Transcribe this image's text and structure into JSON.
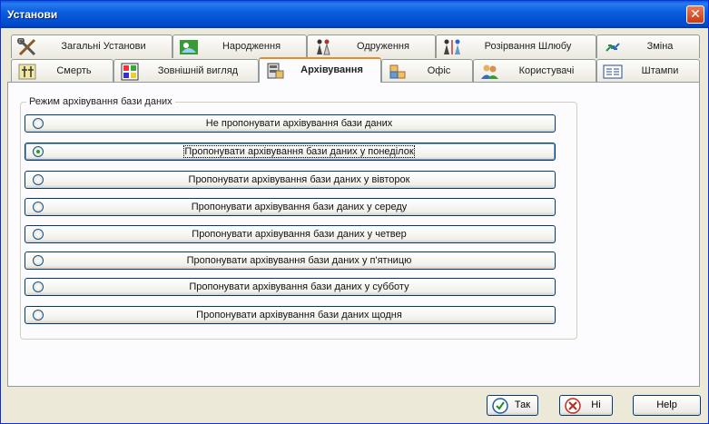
{
  "window": {
    "title": "Установи",
    "close_label": "✕"
  },
  "tabs_row1": [
    {
      "label": "Загальні Установи",
      "icon": "tools-icon"
    },
    {
      "label": "Народження",
      "icon": "birth-icon"
    },
    {
      "label": "Одруження",
      "icon": "wedding-icon"
    },
    {
      "label": "Розірвання Шлюбу",
      "icon": "divorce-icon"
    },
    {
      "label": "Зміна",
      "icon": "change-icon"
    }
  ],
  "tabs_row2": [
    {
      "label": "Смерть",
      "icon": "death-icon"
    },
    {
      "label": "Зовнішній вигляд",
      "icon": "appearance-icon"
    },
    {
      "label": "Архівування",
      "icon": "archive-icon",
      "active": true
    },
    {
      "label": "Офіс",
      "icon": "office-icon"
    },
    {
      "label": "Користувачі",
      "icon": "users-icon"
    },
    {
      "label": "Штампи",
      "icon": "stamps-icon"
    }
  ],
  "group": {
    "label": "Режим архівування бази даних",
    "options": [
      {
        "label": "Не пропонувати архівування бази даних",
        "selected": false
      },
      {
        "label": "Пропонувати архівування бази даних у понеділок",
        "selected": true
      },
      {
        "label": "Пропонувати архівування бази даних у вівторок",
        "selected": false
      },
      {
        "label": "Пропонувати архівування бази даних у середу",
        "selected": false
      },
      {
        "label": "Пропонувати архівування бази даних у четвер",
        "selected": false
      },
      {
        "label": "Пропонувати архівування бази даних у п'ятницю",
        "selected": false
      },
      {
        "label": "Пропонувати архівування бази даних у субботу",
        "selected": false
      },
      {
        "label": "Пропонувати архівування бази даних щодня",
        "selected": false
      }
    ]
  },
  "buttons": {
    "ok_label": "Так",
    "no_label": "Ні",
    "help_label": "Help"
  }
}
